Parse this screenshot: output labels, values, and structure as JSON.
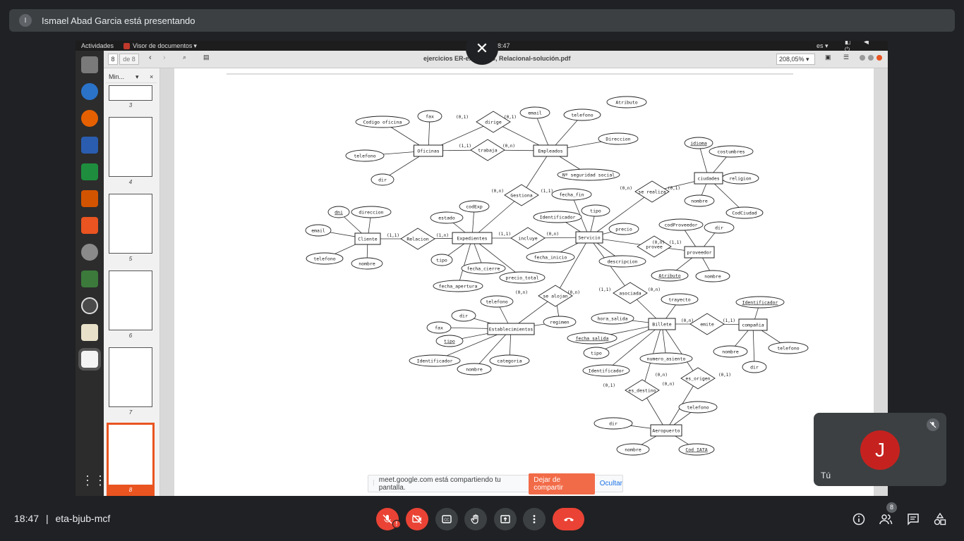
{
  "presenter": {
    "initial": "I",
    "text": "Ismael Abad Garcia está presentando"
  },
  "gnome": {
    "activities": "Actividades",
    "app_menu": "Visor de documentos",
    "clock": "8:47",
    "lang": "es"
  },
  "viewer": {
    "page_current": "8",
    "page_of": "de 8",
    "title": "ejercicios ER-extendido, Relacional-solución.pdf",
    "zoom": "208,05%",
    "sidebar_mode": "Min...",
    "thumb_labels": [
      "3",
      "4",
      "5",
      "6",
      "7",
      "8"
    ]
  },
  "diagram": {
    "entities": [
      "Oficinas",
      "Empleados",
      "Cliente",
      "Expedientes",
      "Servicio",
      "ciudades",
      "proveedor",
      "Establecimientos",
      "Billete",
      "compañia",
      "Aeropuerto"
    ],
    "relationships": [
      "dirige",
      "trabaja",
      "Gestiona",
      "Relacion",
      "incluye",
      "se realiza",
      "provee",
      "se alojan",
      "asociada",
      "emite",
      "es_destino",
      "es_origen"
    ],
    "attributes": [
      "Atributo",
      "fax",
      "Codigo oficina",
      "email",
      "telefono",
      "Direccion",
      "telefono",
      "dir",
      "Nº seguridad social",
      "idioma",
      "costumbres",
      "religion",
      "nombre",
      "CodCiudad",
      "dni",
      "direccion",
      "email",
      "telefono",
      "nombre",
      "codExp",
      "estado",
      "tipo",
      "fecha_cierre",
      "precio_total",
      "fecha_apertura",
      "fecha_fin",
      "Identificador",
      "tipo",
      "precio",
      "fecha_inicio",
      "descripcion",
      "codProveedor",
      "dir",
      "Atributo",
      "nombre",
      "telefono",
      "dir",
      "fax",
      "tipo",
      "Identificador",
      "nombre",
      "categoria",
      "regimen",
      "trayecto",
      "hora_salida",
      "fecha_salida",
      "tipo",
      "Identificador",
      "numero_asiento",
      "Identificador",
      "nombre",
      "telefono",
      "dir",
      "telefono",
      "dir",
      "nombre",
      "Cod_IATA"
    ],
    "cardinalities": [
      "(0,1)",
      "(0,1)",
      "(1,1)",
      "(0,n)",
      "(0,n)",
      "(1,1)",
      "(0,n)",
      "(0,1)",
      "(1,1)",
      "(1,n)",
      "(1,1)",
      "(0,n)",
      "(0,n)",
      "(1,1)",
      "(0,n)",
      "(0,n)",
      "(1,1)",
      "(0,n)",
      "(0,n)",
      "(1,1)",
      "(0,1)",
      "(0,n)",
      "(0,n)",
      "(0,1)"
    ]
  },
  "share": {
    "text": "meet.google.com está compartiendo tu pantalla.",
    "stop": "Dejar de compartir",
    "hide": "Ocultar"
  },
  "self_tile": {
    "initial": "J",
    "label": "Tú"
  },
  "meeting": {
    "time": "18:47",
    "separator": "|",
    "code": "eta-bjub-mcf",
    "participants": "8"
  },
  "colors": {
    "accent_red": "#ea4335",
    "avatar_red": "#c5221f",
    "link_blue": "#1a73e8",
    "stop_orange": "#f26b48"
  }
}
